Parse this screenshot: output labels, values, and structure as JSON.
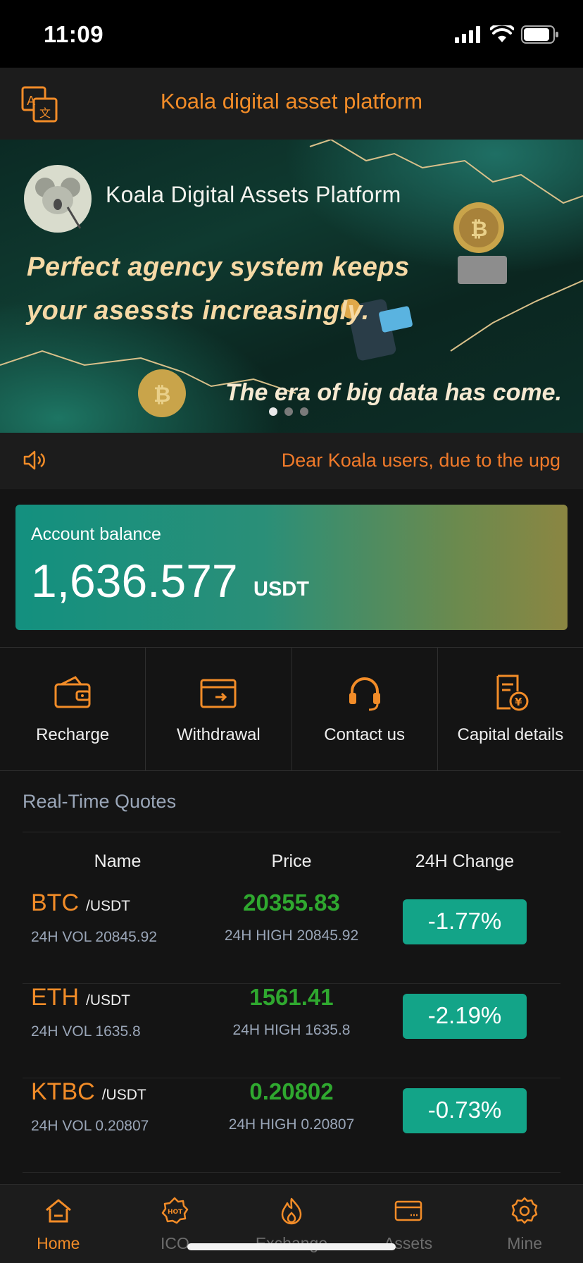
{
  "status_bar": {
    "time": "11:09"
  },
  "header": {
    "title": "Koala digital asset platform",
    "translate_icon": "translate-icon"
  },
  "banner": {
    "brand": "Koala Digital Assets Platform",
    "line1": "Perfect agency system keeps",
    "line2": "your asessts increasingly.",
    "line3": "The era of big data has come.",
    "slide_count": 3,
    "active_slide": 1
  },
  "notice": {
    "text": "Dear Koala users, due to the upg",
    "icon": "speaker-icon"
  },
  "balance": {
    "label": "Account balance",
    "amount": "1,636.577",
    "unit": "USDT"
  },
  "actions": [
    {
      "label": "Recharge",
      "icon": "wallet-icon"
    },
    {
      "label": "Withdrawal",
      "icon": "withdraw-icon"
    },
    {
      "label": "Contact us",
      "icon": "headset-icon"
    },
    {
      "label": "Capital details",
      "icon": "document-yen-icon"
    }
  ],
  "quotes": {
    "title": "Real-Time Quotes",
    "headers": {
      "name": "Name",
      "price": "Price",
      "change": "24H Change"
    },
    "rows": [
      {
        "symbol": "BTC",
        "quote": "/USDT",
        "vol": "24H VOL 20845.92",
        "price": "20355.83",
        "high": "24H HIGH 20845.92",
        "change": "-1.77%"
      },
      {
        "symbol": "ETH",
        "quote": "/USDT",
        "vol": "24H VOL 1635.8",
        "price": "1561.41",
        "high": "24H HIGH 1635.8",
        "change": "-2.19%"
      },
      {
        "symbol": "KTBC",
        "quote": "/USDT",
        "vol": "24H VOL 0.20807",
        "price": "0.20802",
        "high": "24H HIGH 0.20807",
        "change": "-0.73%"
      }
    ]
  },
  "tabbar": [
    {
      "label": "Home",
      "icon": "home-icon",
      "active": true
    },
    {
      "label": "ICO",
      "icon": "hot-icon",
      "active": false
    },
    {
      "label": "Exchange",
      "icon": "flame-icon",
      "active": false
    },
    {
      "label": "Assets",
      "icon": "card-icon",
      "active": false
    },
    {
      "label": "Mine",
      "icon": "gear-icon",
      "active": false
    }
  ],
  "colors": {
    "accent": "#f28c28",
    "price_green": "#2fa82f",
    "change_bg": "#13a488",
    "background": "#141414"
  }
}
